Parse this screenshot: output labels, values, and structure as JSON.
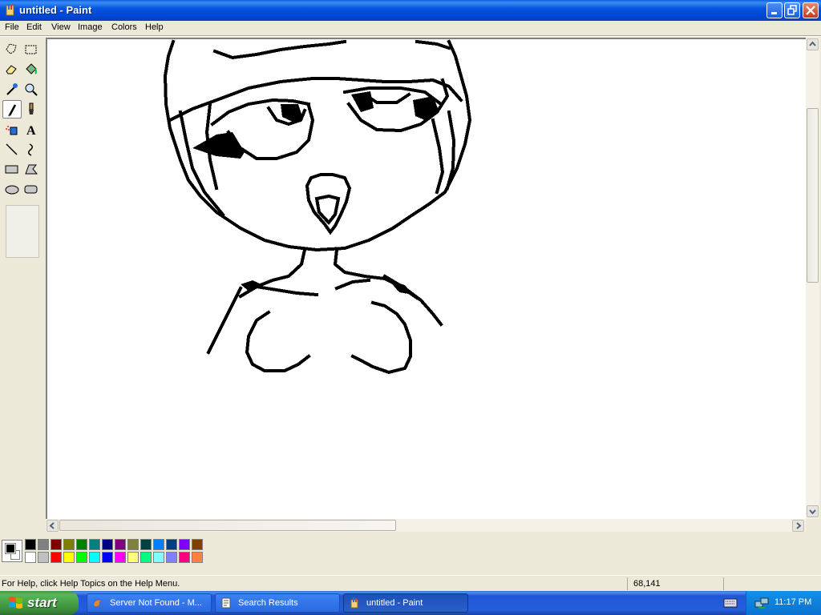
{
  "window": {
    "title": "untitled - Paint"
  },
  "menu": [
    "File",
    "Edit",
    "View",
    "Image",
    "Colors",
    "Help"
  ],
  "tools": [
    {
      "name": "free-form-select-icon"
    },
    {
      "name": "select-icon"
    },
    {
      "name": "eraser-icon"
    },
    {
      "name": "fill-icon"
    },
    {
      "name": "pick-color-icon"
    },
    {
      "name": "magnifier-icon"
    },
    {
      "name": "pencil-icon"
    },
    {
      "name": "brush-icon"
    },
    {
      "name": "airbrush-icon"
    },
    {
      "name": "text-icon"
    },
    {
      "name": "line-icon"
    },
    {
      "name": "curve-icon"
    },
    {
      "name": "rectangle-icon"
    },
    {
      "name": "polygon-icon"
    },
    {
      "name": "ellipse-icon"
    },
    {
      "name": "rounded-rectangle-icon"
    }
  ],
  "tool_text_glyph": "A",
  "selected_tool": "pencil",
  "palette": {
    "foreground": "#000000",
    "background": "#FFFFFF",
    "colors": [
      "#000000",
      "#808080",
      "#800000",
      "#808000",
      "#008000",
      "#008080",
      "#000080",
      "#800080",
      "#808040",
      "#004040",
      "#0080FF",
      "#004080",
      "#8000FF",
      "#804000",
      "#FFFFFF",
      "#C0C0C0",
      "#FF0000",
      "#FFFF00",
      "#00FF00",
      "#00FFFF",
      "#0000FF",
      "#FF00FF",
      "#FFFF80",
      "#00FF80",
      "#80FFFF",
      "#8080FF",
      "#FF0080",
      "#FF8040"
    ]
  },
  "status": {
    "help": "For Help, click Help Topics on the Help Menu.",
    "coords": "68,141"
  },
  "taskbar": {
    "start": "start",
    "tasks": [
      {
        "label": "Server Not Found - M...",
        "active": false
      },
      {
        "label": "Search Results",
        "active": false
      },
      {
        "label": "untitled - Paint",
        "active": true
      }
    ],
    "clock": "11:17 PM"
  }
}
